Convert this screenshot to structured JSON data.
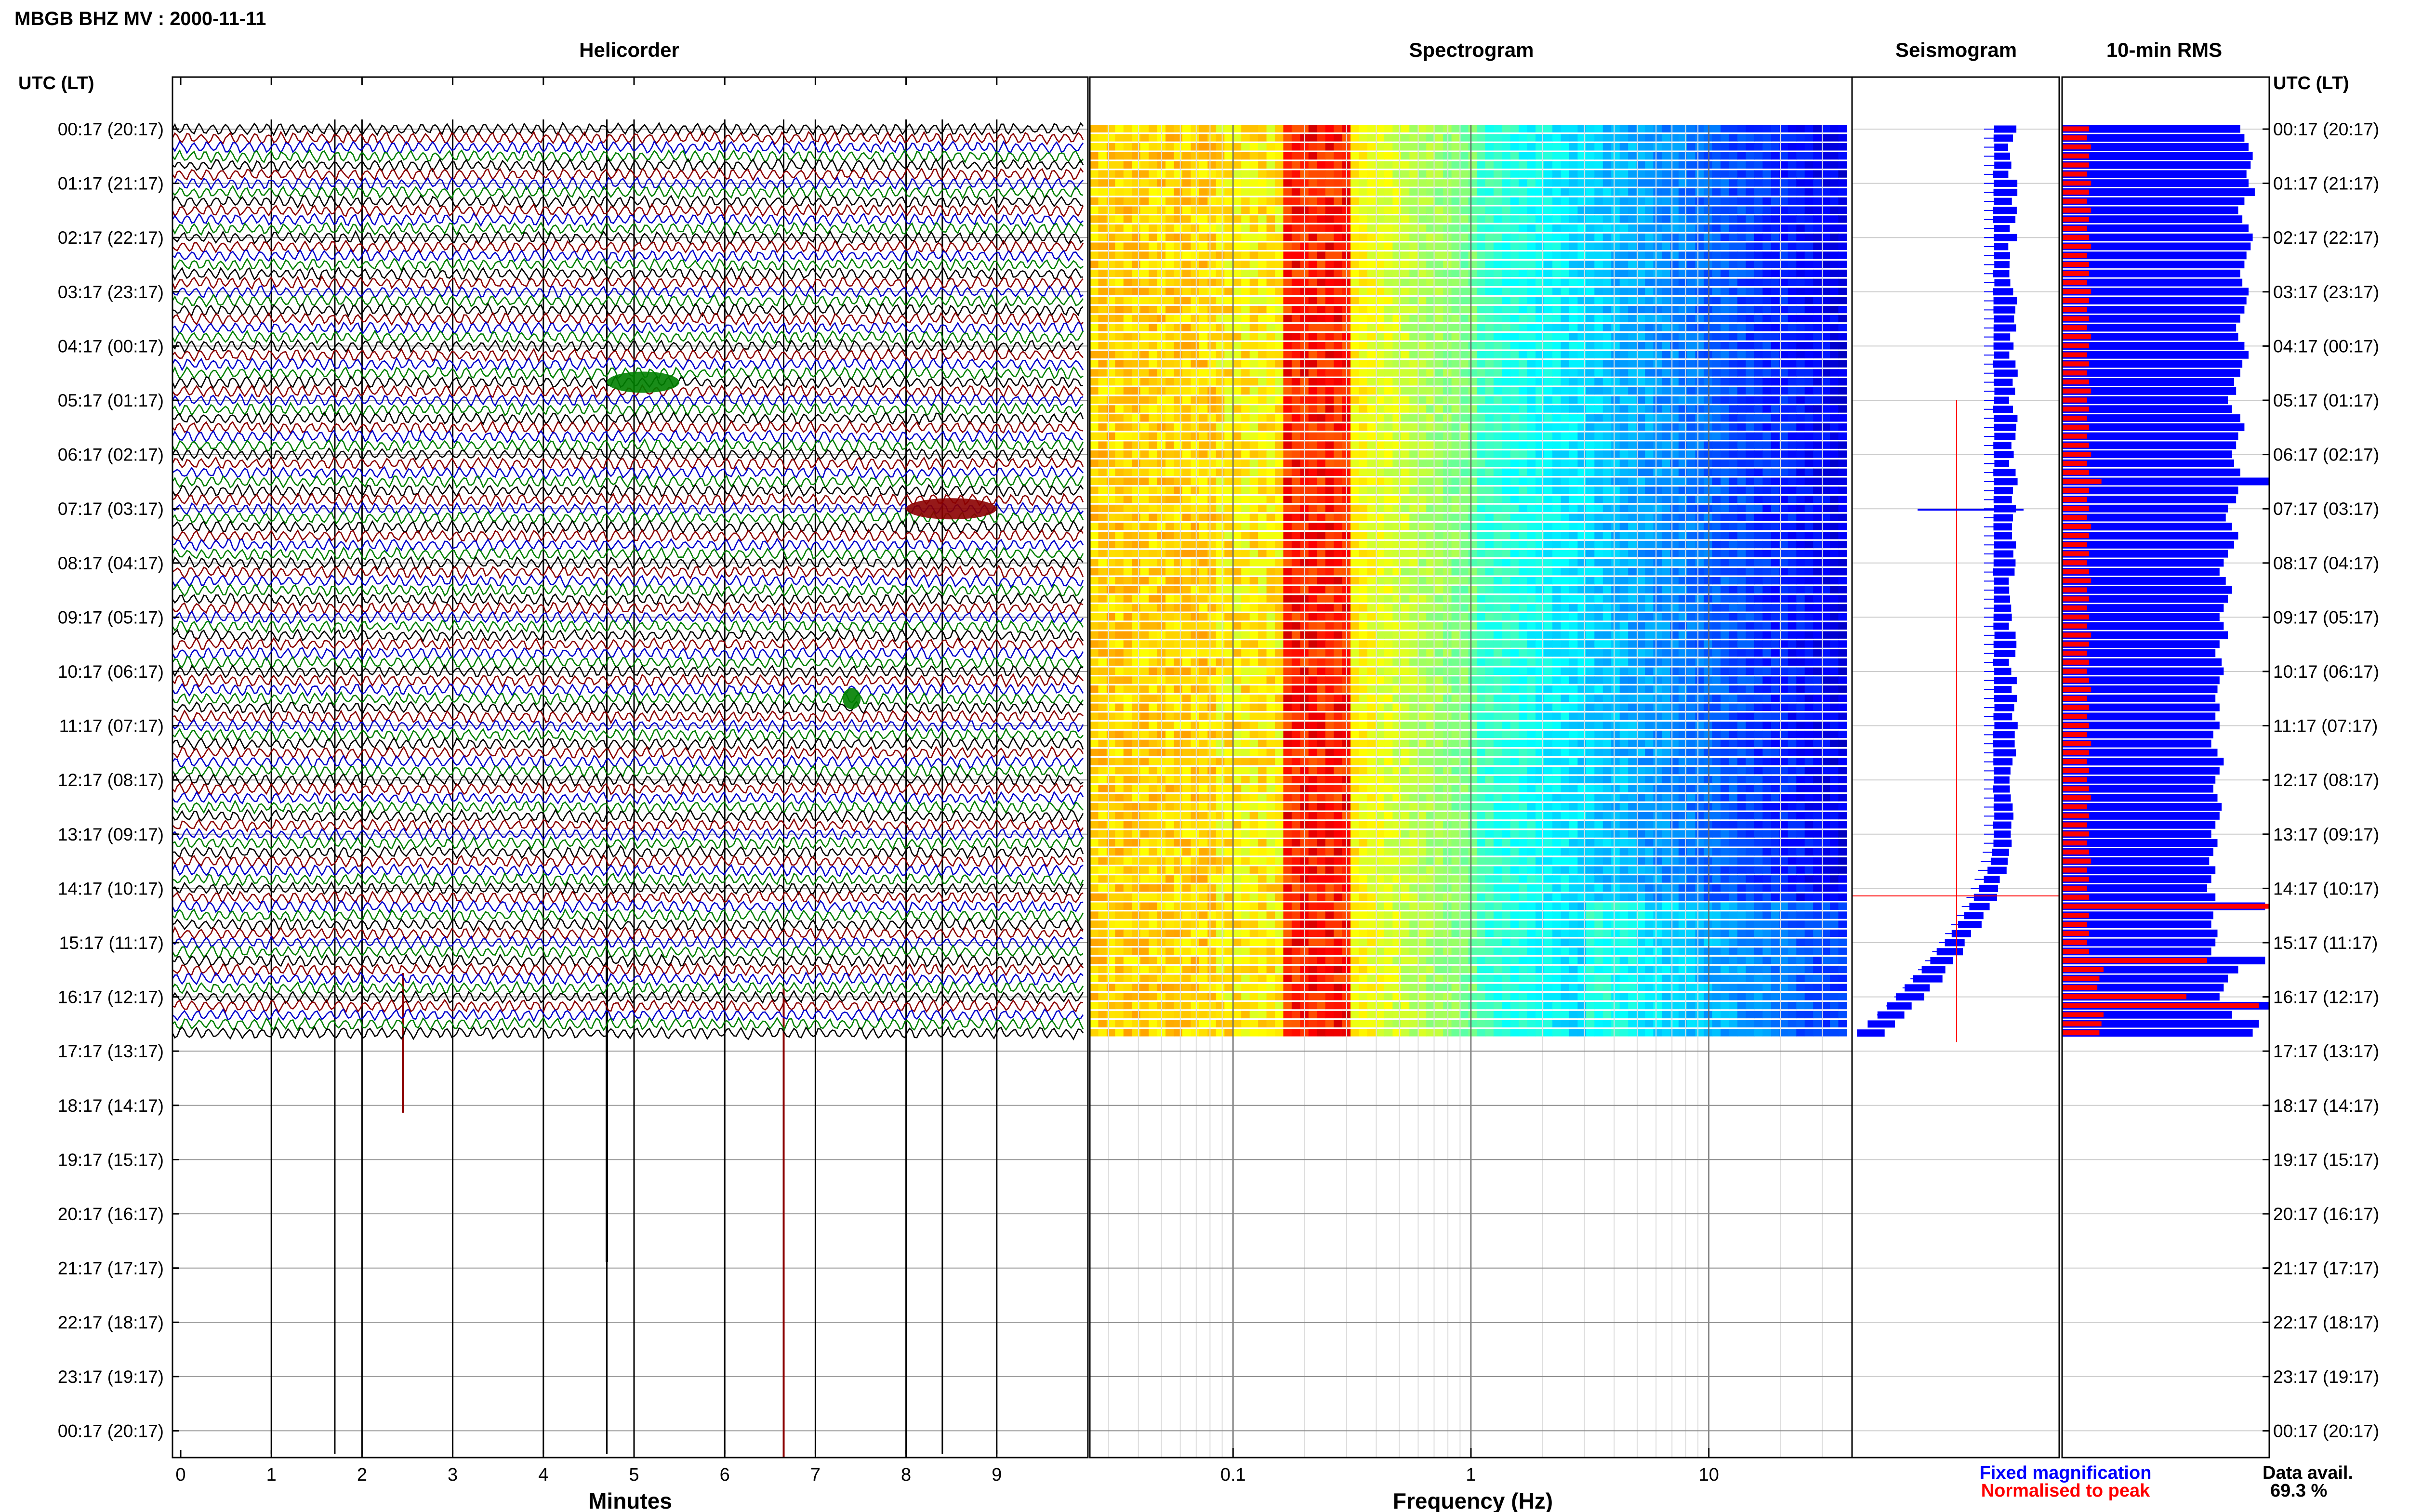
{
  "header": {
    "title": "MBGB BHZ MV : 2000-11-11"
  },
  "panels": {
    "helicorder": "Helicorder",
    "spectrogram": "Spectrogram",
    "seismogram": "Seismogram",
    "rms": "10-min RMS"
  },
  "axes": {
    "left_title": "UTC (LT)",
    "right_title": "UTC (LT)",
    "minutes_label": "Minutes",
    "frequency_label": "Frequency (Hz)",
    "minute_ticks": [
      "0",
      "1",
      "2",
      "3",
      "4",
      "5",
      "6",
      "7",
      "8",
      "9"
    ],
    "frequency_ticks": [
      "0.1",
      "1",
      "10"
    ],
    "time_labels": [
      "00:17 (20:17)",
      "01:17 (21:17)",
      "02:17 (22:17)",
      "03:17 (23:17)",
      "04:17 (00:17)",
      "05:17 (01:17)",
      "06:17 (02:17)",
      "07:17 (03:17)",
      "08:17 (04:17)",
      "09:17 (05:17)",
      "10:17 (06:17)",
      "11:17 (07:17)",
      "12:17 (08:17)",
      "13:17 (09:17)",
      "14:17 (10:17)",
      "15:17 (11:17)",
      "16:17 (12:17)",
      "17:17 (13:17)",
      "18:17 (14:17)",
      "19:17 (15:17)",
      "20:17 (16:17)",
      "21:17 (17:17)",
      "22:17 (18:17)",
      "23:17 (19:17)",
      "00:17 (20:17)"
    ]
  },
  "legend": {
    "fixed": "Fixed magnification",
    "normalised": "Normalised to peak",
    "fixed_color": "#0000ff",
    "normalised_color": "#ff0000"
  },
  "data_availability": {
    "label": "Data avail.",
    "value": "69.3 %"
  },
  "colors": {
    "trace_cycle": [
      "#000000",
      "#8b0000",
      "#0000cd",
      "#008000"
    ],
    "rms_fixed": "#0000ff",
    "rms_normalised": "#ff0000"
  },
  "chart_data": [
    {
      "type": "line",
      "panel": "Helicorder",
      "xlabel": "Minutes",
      "xlim": [
        0,
        10
      ],
      "rows_per_hour": 6,
      "rows_with_data": 101,
      "rows_total": 145,
      "notable_events": [
        {
          "start_min": 4.7,
          "end_min": 5.5,
          "time": "04:57",
          "note": "large green burst"
        },
        {
          "start_min": 8.0,
          "end_min": 9.0,
          "time": "07:17",
          "note": "large dark-red burst"
        },
        {
          "start_min": 7.3,
          "end_min": 7.5,
          "time": "10:47",
          "note": "green burst"
        }
      ]
    },
    {
      "type": "heatmap",
      "panel": "Spectrogram",
      "xlabel": "Frequency (Hz)",
      "xscale": "log",
      "xlim": [
        0.025,
        40
      ],
      "dominant_band_hz": [
        0.15,
        0.3
      ],
      "colormap": "jet"
    },
    {
      "type": "bar",
      "panel": "Seismogram",
      "note": "per-row amplitude envelope, fixed magnification (blue) and normalised to peak (red)",
      "amplitude_trend": "increasing after 13:17 UTC"
    },
    {
      "type": "bar",
      "panel": "10-min RMS",
      "series": [
        {
          "name": "Fixed magnification",
          "values": [
            0.86,
            0.88,
            0.9,
            0.92,
            0.91,
            0.89,
            0.9,
            0.93,
            0.88,
            0.85,
            0.87,
            0.9,
            0.92,
            0.91,
            0.89,
            0.88,
            0.86,
            0.87,
            0.9,
            0.89,
            0.88,
            0.86,
            0.84,
            0.85,
            0.88,
            0.9,
            0.87,
            0.86,
            0.83,
            0.84,
            0.8,
            0.82,
            0.86,
            0.88,
            0.85,
            0.84,
            0.82,
            0.83,
            0.86,
            1.0,
            0.85,
            0.84,
            0.8,
            0.79,
            0.82,
            0.85,
            0.83,
            0.8,
            0.78,
            0.76,
            0.79,
            0.82,
            0.8,
            0.78,
            0.76,
            0.78,
            0.8,
            0.76,
            0.74,
            0.77,
            0.78,
            0.76,
            0.75,
            0.74,
            0.76,
            0.74,
            0.76,
            0.73,
            0.72,
            0.75,
            0.78,
            0.76,
            0.74,
            0.73,
            0.75,
            0.77,
            0.76,
            0.74,
            0.72,
            0.75,
            0.73,
            0.71,
            0.74,
            0.72,
            0.7,
            0.74,
            0.98,
            0.73,
            0.72,
            0.75,
            0.74,
            0.72,
            0.98,
            0.85,
            0.8,
            0.78,
            0.76,
            1.0,
            0.82,
            0.95,
            0.92
          ]
        },
        {
          "name": "Normalised to peak",
          "values": [
            0.13,
            0.12,
            0.14,
            0.13,
            0.13,
            0.12,
            0.14,
            0.13,
            0.12,
            0.14,
            0.13,
            0.12,
            0.13,
            0.14,
            0.12,
            0.13,
            0.13,
            0.12,
            0.14,
            0.13,
            0.12,
            0.13,
            0.12,
            0.14,
            0.13,
            0.12,
            0.13,
            0.12,
            0.13,
            0.14,
            0.12,
            0.13,
            0.12,
            0.13,
            0.12,
            0.13,
            0.14,
            0.12,
            0.13,
            0.19,
            0.13,
            0.12,
            0.13,
            0.12,
            0.14,
            0.13,
            0.12,
            0.13,
            0.12,
            0.13,
            0.14,
            0.12,
            0.13,
            0.12,
            0.13,
            0.12,
            0.14,
            0.13,
            0.12,
            0.13,
            0.12,
            0.13,
            0.14,
            0.12,
            0.13,
            0.12,
            0.13,
            0.12,
            0.14,
            0.13,
            0.12,
            0.13,
            0.12,
            0.13,
            0.14,
            0.12,
            0.13,
            0.12,
            0.13,
            0.12,
            0.13,
            0.14,
            0.12,
            0.13,
            0.12,
            0.13,
            1.0,
            0.13,
            0.12,
            0.13,
            0.12,
            0.13,
            0.7,
            0.2,
            0.18,
            0.17,
            0.6,
            0.95,
            0.2,
            0.19,
            0.18
          ]
        }
      ]
    }
  ]
}
